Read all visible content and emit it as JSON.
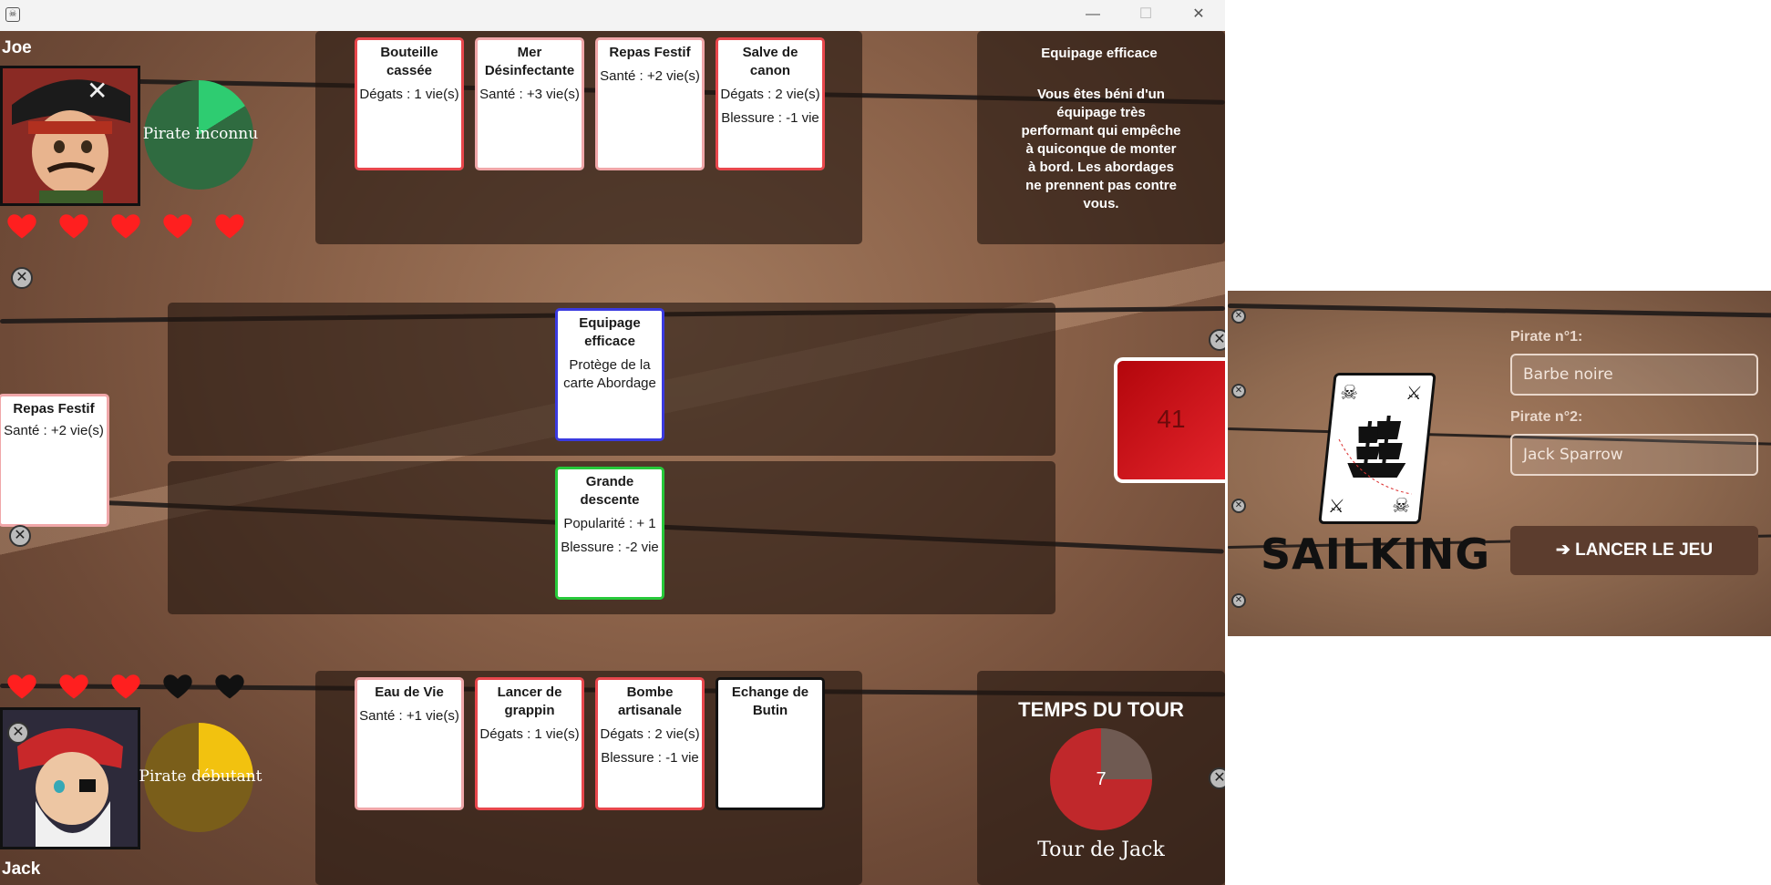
{
  "window": {
    "minimize_glyph": "—",
    "maximize_glyph": "☐",
    "close_glyph": "✕"
  },
  "opponent": {
    "name": "Joe",
    "rank": "Pirate inconnu",
    "rank_progress": 0.16,
    "lives": 5,
    "max_lives": 5,
    "hand": [
      {
        "title": "Bouteille cassée",
        "lines": [
          "Dégats : 1 vie(s)"
        ],
        "border": "red"
      },
      {
        "title": "Mer Désinfectante",
        "lines": [
          "Santé : +3 vie(s)"
        ],
        "border": "pink"
      },
      {
        "title": "Repas Festif",
        "lines": [
          "Santé : +2 vie(s)"
        ],
        "border": "pink"
      },
      {
        "title": "Salve de canon",
        "lines": [
          "Dégats : 2 vie(s)",
          "Blessure : -1 vie"
        ],
        "border": "red"
      }
    ]
  },
  "info_panel": {
    "title": "Equipage efficace",
    "text": "Vous êtes béni d'un équipage très performant qui empêche à quiconque de monter à bord. Les abordages ne prennent pas contre vous."
  },
  "table": {
    "opponent_played": {
      "title": "Equipage efficace",
      "lines": [
        "Protège de la carte Abordage"
      ],
      "border": "blue"
    },
    "player_played": {
      "title": "Grande descente",
      "lines": [
        "Popularité : + 1",
        "Blessure : -2 vie"
      ],
      "border": "green"
    },
    "discard": {
      "title": "Repas Festif",
      "lines": [
        "Santé : +2 vie(s)"
      ],
      "border": "pink"
    }
  },
  "deck": {
    "count": "41"
  },
  "player": {
    "name": "Jack",
    "rank": "Pirate débutant",
    "rank_progress": 0.25,
    "lives": 3,
    "max_lives": 5,
    "hand": [
      {
        "title": "Eau de Vie",
        "lines": [
          "Santé : +1 vie(s)"
        ],
        "border": "pink"
      },
      {
        "title": "Lancer de grappin",
        "lines": [
          "Dégats : 1 vie(s)"
        ],
        "border": "red"
      },
      {
        "title": "Bombe artisanale",
        "lines": [
          "Dégats : 2 vie(s)",
          "Blessure : -1 vie"
        ],
        "border": "red"
      },
      {
        "title": "Echange de Butin",
        "lines": [],
        "border": "black"
      }
    ]
  },
  "timer": {
    "title": "TEMPS DU TOUR",
    "value": "7",
    "elapsed_fraction": 0.75,
    "turn_label": "Tour de Jack"
  },
  "launcher": {
    "logo": "SAILKING",
    "pirate1_label": "Pirate n°1:",
    "pirate1_placeholder": "Barbe noire",
    "pirate2_label": "Pirate n°2:",
    "pirate2_placeholder": "Jack Sparrow",
    "launch_label": "LANCER LE JEU"
  },
  "colors": {
    "red_border": "#e8474c",
    "pink_border": "#f0a7a9",
    "blue_border": "#3a3ae0",
    "green_border": "#27c93a",
    "heart_full": "#ff1f1f",
    "heart_empty": "#111111",
    "opponent_rank_fill": "#2ecc71",
    "opponent_rank_bg": "#2f6b40",
    "player_rank_fill": "#f2c20f",
    "player_rank_bg": "#7a5e1a",
    "timer_fill": "#c0282b",
    "timer_rest": "#6f5a52"
  }
}
